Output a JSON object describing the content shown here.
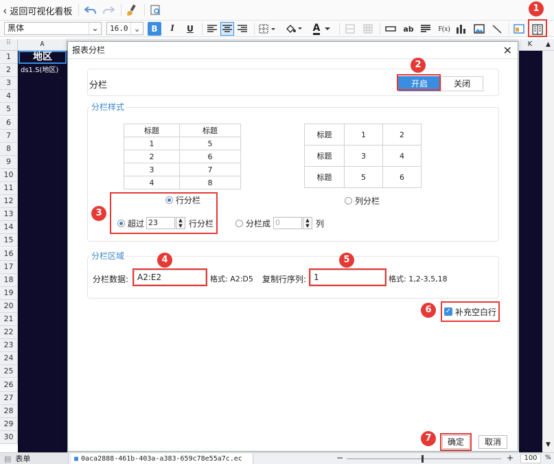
{
  "toolbar": {
    "back_label": "返回可视化看板",
    "font_name": "黑体",
    "font_size": "16.0",
    "bold": "B",
    "italic": "I",
    "underline": "U",
    "text_ab": "ab",
    "fx": "F(x)",
    "text_A": "A"
  },
  "sheet": {
    "col_a": "A",
    "col_k": "K",
    "cell_a1": "地区",
    "cell_a2": "ds1.S(地区)",
    "rows": [
      "1",
      "2",
      "3",
      "4",
      "5",
      "6",
      "7",
      "8",
      "9",
      "10",
      "11",
      "12",
      "13",
      "14",
      "15",
      "16",
      "17",
      "18",
      "19",
      "20",
      "21",
      "22",
      "23",
      "24",
      "25",
      "26",
      "27",
      "28",
      "29",
      "30"
    ]
  },
  "dialog": {
    "title": "报表分栏",
    "section_label": "分栏",
    "on_label": "开启",
    "off_label": "关闭",
    "style_legend": "分栏样式",
    "row_table": {
      "headers": [
        "标题",
        "标题"
      ],
      "rows": [
        [
          "1",
          "5"
        ],
        [
          "2",
          "6"
        ],
        [
          "3",
          "7"
        ],
        [
          "4",
          "8"
        ]
      ]
    },
    "col_table": {
      "rows": [
        [
          "标题",
          "1",
          "2"
        ],
        [
          "标题",
          "3",
          "4"
        ],
        [
          "标题",
          "5",
          "6"
        ]
      ]
    },
    "row_split_label": "行分栏",
    "col_split_label": "列分栏",
    "exceed_label": "超过",
    "exceed_value": "23",
    "exceed_suffix": "行分栏",
    "split_into_label": "分栏成",
    "split_into_value": "0",
    "split_into_suffix": "列",
    "area_legend": "分栏区域",
    "data_label": "分栏数据:",
    "data_value": "A2:E2",
    "format_label_1": "格式: A2:D5",
    "copy_rows_label": "复制行序列:",
    "copy_rows_value": "1",
    "format_label_2": "格式: 1,2-3,5,18",
    "fill_blank_label": "补充空白行",
    "ok_label": "确定",
    "cancel_label": "取消"
  },
  "badges": [
    "1",
    "2",
    "3",
    "4",
    "5",
    "6",
    "7"
  ],
  "status": {
    "sheet_tab": "表单",
    "file_tab": "0aca2888-461b-403a-a383-659c78e55a7c.ec",
    "zoom_minus": "−",
    "zoom_plus": "+",
    "zoom_value": "100",
    "zoom_unit": "%"
  },
  "colors": {
    "accent": "#3b8de0",
    "highlight": "#e53935",
    "dark_cells": "#0e0c2a",
    "section": "#3a86c8"
  }
}
